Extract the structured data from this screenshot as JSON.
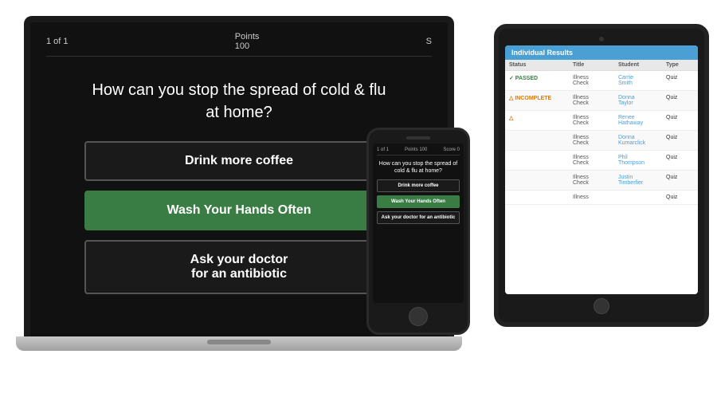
{
  "laptop": {
    "header": {
      "progress": "1 of 1",
      "points_label": "Points",
      "points_value": "100",
      "score_label": "S"
    },
    "question": "How can you stop the spread of cold & flu at home?",
    "answers": [
      {
        "text": "Drink more coffee",
        "correct": false
      },
      {
        "text": "Wash Your Hands Often",
        "correct": true
      },
      {
        "text": "Ask your doctor\nfor an antibiotic",
        "correct": false
      }
    ]
  },
  "phone": {
    "header": {
      "progress": "1 of 1",
      "points": "Points 100",
      "score": "Score 0"
    },
    "question": "How can you stop the spread of cold & flu at home?",
    "answers": [
      {
        "text": "Drink more coffee",
        "correct": false
      },
      {
        "text": "Wash Your Hands Often",
        "correct": true
      },
      {
        "text": "Ask your doctor for an antibiotic",
        "correct": false
      }
    ]
  },
  "tablet": {
    "title": "Individual Results",
    "columns": [
      "Status",
      "Title",
      "Student",
      "Type"
    ],
    "rows": [
      {
        "status": "✓ PASSED",
        "status_type": "passed",
        "title": "Illness Check",
        "student": "Carrie Smith",
        "type": "Quiz"
      },
      {
        "status": "△ INCOMPLETE",
        "status_type": "incomplete",
        "title": "Illness Check",
        "student": "Donna Taylor",
        "type": "Quiz"
      },
      {
        "status": "△",
        "status_type": "incomplete",
        "title": "Illness Check",
        "student": "Renee Hathaway",
        "type": "Quiz"
      },
      {
        "status": "",
        "status_type": "none",
        "title": "Illness Check",
        "student": "Donna Kumarclick",
        "type": "Quiz"
      },
      {
        "status": "",
        "status_type": "none",
        "title": "Illness Check",
        "student": "Phil Thompson",
        "type": "Quiz"
      },
      {
        "status": "",
        "status_type": "none",
        "title": "Illness Check",
        "student": "Justin Timberfier",
        "type": "Quiz"
      },
      {
        "status": "",
        "status_type": "none",
        "title": "Illness",
        "student": "",
        "type": "Quiz"
      }
    ]
  },
  "colors": {
    "accent_blue": "#4a9fd4",
    "correct_green": "#3a7d44",
    "laptop_bg": "#111111",
    "tablet_bg": "#ffffff"
  }
}
